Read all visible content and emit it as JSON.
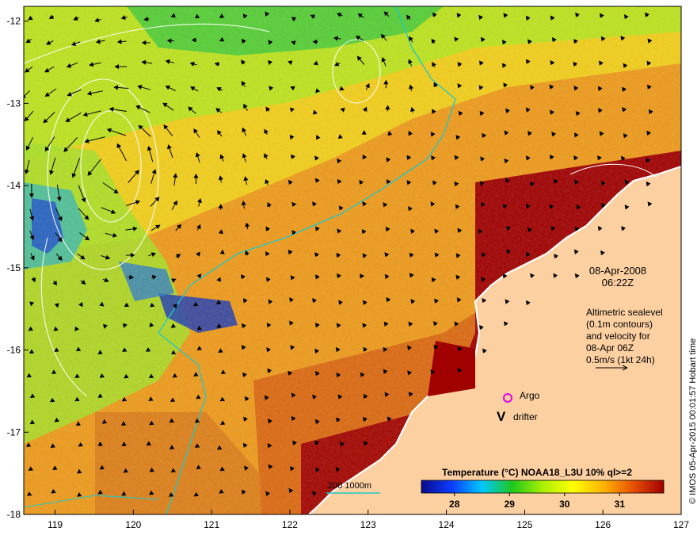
{
  "map": {
    "x_ticks": [
      "119",
      "120",
      "121",
      "122",
      "123",
      "124",
      "125",
      "126",
      "127"
    ],
    "y_ticks": [
      "-12",
      "-13",
      "-14",
      "-15",
      "-16",
      "-17",
      "-18"
    ],
    "date": "08-Apr-2008",
    "time": "06:22Z",
    "info_lines": [
      "Altimetric sealevel",
      "(0.1m contours)",
      "and velocity for",
      "08-Apr 06Z",
      "0.5m/s (1kt 24h)"
    ],
    "legend": {
      "argo": "Argo",
      "drifter": "drifter",
      "drifter_symbol": "V"
    },
    "bathymetry_label": "200  1000m",
    "colorbar": {
      "title": "Temperature (°C) NOAA18_L3U 10% ql>=2",
      "ticks": [
        "28",
        "29",
        "30",
        "31"
      ],
      "tick_values": [
        28,
        29,
        30,
        31
      ],
      "range": [
        27.4,
        31.8
      ],
      "colors": [
        "#0a0a8c",
        "#0a3cff",
        "#00c8ff",
        "#1ec81e",
        "#aaf000",
        "#ffff00",
        "#ffb400",
        "#e65000",
        "#a00000"
      ]
    },
    "credit": "© IMOS 05-Apr-2015 00:01:57 Hobart time",
    "colors": {
      "land": "#fdd0a2",
      "coast": "#ffffff",
      "bathy": "#20c8c8",
      "marker": "#e600e6"
    }
  }
}
